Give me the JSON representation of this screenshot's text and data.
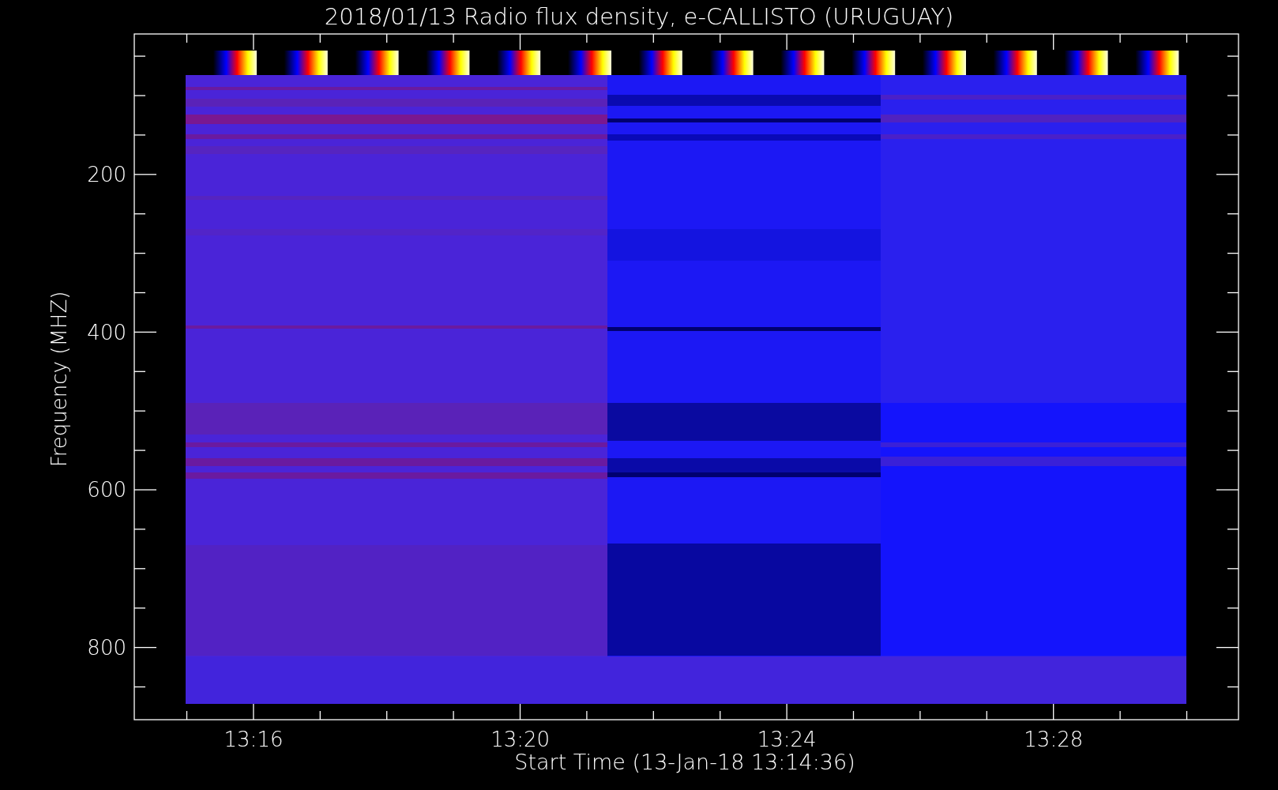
{
  "title": "2018/01/13  Radio flux density, e-CALLISTO (URUGUAY)",
  "plot": {
    "xlabel": "Start Time (13-Jan-18 13:14:36)",
    "ylabel": "Frequency (MHZ)",
    "xticks": [
      "13:16",
      "13:20",
      "13:24",
      "13:28"
    ],
    "yticks": [
      "200",
      "400",
      "600",
      "800"
    ]
  }
}
